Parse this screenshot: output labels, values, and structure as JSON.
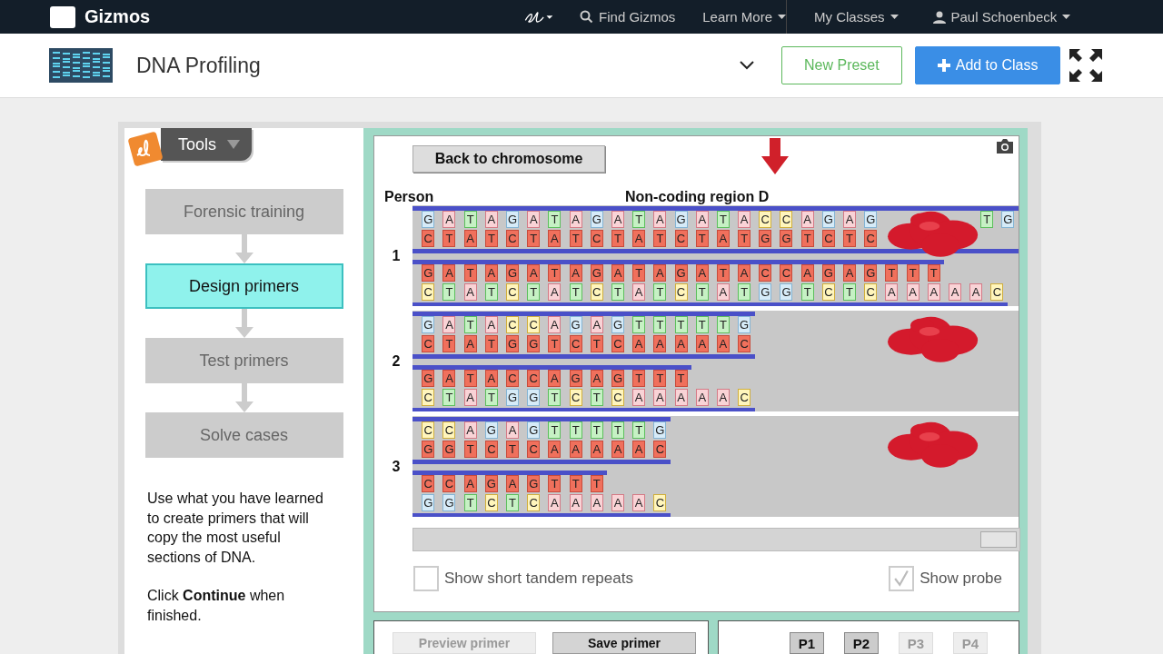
{
  "nav": {
    "logo": "Gizmos",
    "items": [
      {
        "label": "Find Gizmos",
        "kind": "search"
      },
      {
        "label": "Learn More",
        "kind": "menu"
      }
    ],
    "account": [
      {
        "label": "My Classes",
        "kind": "menu"
      },
      {
        "label": "Paul Schoenbeck",
        "kind": "user"
      }
    ]
  },
  "header": {
    "title": "DNA Profiling",
    "buttons": [
      {
        "label": "New Preset",
        "kind": "outline"
      },
      {
        "label": "Add to Class",
        "kind": "primary"
      }
    ]
  },
  "tools": {
    "label": "Tools"
  },
  "steps": [
    {
      "label": "Forensic training",
      "selected": false
    },
    {
      "label": "Design primers",
      "selected": true
    },
    {
      "label": "Test primers",
      "selected": false
    },
    {
      "label": "Solve cases",
      "selected": false
    }
  ],
  "instructions": [
    "Use what you have learned to create primers that will copy the most useful sections of DNA.",
    "Click **Continue** when finished."
  ],
  "viewer": {
    "back_button": "Back to chromosome",
    "column_1": "Person",
    "column_2": "Non-coding region D",
    "persons": [
      {
        "label": "1",
        "probe": true,
        "duplexes": [
          {
            "strands": [
              {
                "bases": "G A T A G A T A G A T A G A T A C C A G A G",
                "highlighted": false,
                "covered": true,
                "after": "T G"
              },
              {
                "bases": "C T A T C T A T C T A T C T A T G G T C T C",
                "highlighted": true,
                "covered": true
              }
            ]
          },
          {
            "strands": [
              {
                "bases": "G A T A G A T A G A T A G A T A C C A G A G T T T",
                "highlighted": true,
                "covered": false
              },
              {
                "bases": "C T A T C T A T C T A T C T A T G G T C T C A A A A A C",
                "highlighted": false,
                "covered": false
              }
            ]
          }
        ]
      },
      {
        "label": "2",
        "probe": true,
        "duplexes": [
          {
            "strands": [
              {
                "bases": "G A T A C C A G A G T T T T T G",
                "highlighted": false,
                "covered": false
              },
              {
                "bases": "C T A T G G T C T C A A A A A C",
                "highlighted": true,
                "covered": false
              }
            ]
          },
          {
            "strands": [
              {
                "bases": "G A T A C C A G A G T T T",
                "highlighted": true,
                "covered": false
              },
              {
                "bases": "C T A T G G T C T C A A A A A C",
                "highlighted": false,
                "covered": false
              }
            ]
          }
        ]
      },
      {
        "label": "3",
        "probe": true,
        "duplexes": [
          {
            "strands": [
              {
                "bases": "C C A G A G T T T T T G",
                "highlighted": false,
                "covered": false
              },
              {
                "bases": "G G T C T C A A A A A C",
                "highlighted": true,
                "covered": false
              }
            ]
          },
          {
            "strands": [
              {
                "bases": "C C A G A G T T T",
                "highlighted": true,
                "covered": false
              },
              {
                "bases": "G G T C T C A A A A A C",
                "highlighted": false,
                "covered": false
              }
            ]
          }
        ]
      }
    ]
  },
  "options": [
    {
      "label": "Show short tandem repeats",
      "checked": false
    },
    {
      "label": "Show probe",
      "checked": true
    }
  ],
  "actions": [
    {
      "label": "Preview primer",
      "disabled": true
    },
    {
      "label": "Save primer",
      "disabled": false
    }
  ],
  "primers": [
    {
      "label": "P1",
      "disabled": false
    },
    {
      "label": "P2",
      "disabled": false
    },
    {
      "label": "P3",
      "disabled": true
    },
    {
      "label": "P4",
      "disabled": true
    }
  ]
}
